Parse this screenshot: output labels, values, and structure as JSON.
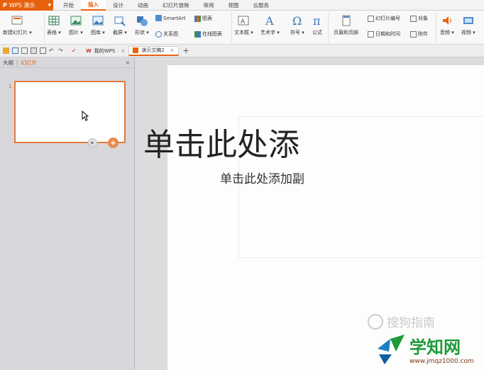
{
  "app": {
    "name": "WPS 演示"
  },
  "menu": {
    "tabs": [
      "开始",
      "插入",
      "设计",
      "动画",
      "幻灯片放映",
      "审阅",
      "视图",
      "云服务"
    ],
    "active_index": 1
  },
  "ribbon": {
    "new_slide": "新建幻灯片",
    "table": "表格",
    "picture": "图片",
    "gallery": "图库",
    "screenshot": "截屏",
    "shape": "形状",
    "smartart": "SmartArt",
    "chart": "图表",
    "relation": "关系图",
    "online_chart": "在线图表",
    "textbox": "文本框",
    "wordart": "艺术字",
    "symbol": "符号",
    "formula": "公式",
    "header_footer": "页眉和页脚",
    "slide_number": "幻灯片编号",
    "object": "对象",
    "date_time": "日期和时间",
    "attachment": "附件",
    "audio": "音频",
    "video": "视频"
  },
  "doc_tabs": [
    {
      "label": "我的WPS"
    },
    {
      "label": "演示文稿2"
    }
  ],
  "left_panel": {
    "outline_label": "大纲",
    "slides_label": "幻灯片",
    "slide_number": "1"
  },
  "slide": {
    "title": "单击此处添",
    "subtitle": "单击此处添加副"
  },
  "watermarks": {
    "sogou": "搜狗指南",
    "site_name": "学知网",
    "site_url": "www.jmqz1000.com"
  },
  "colors": {
    "accent": "#e8620e",
    "thumb_border": "#e07b3b"
  }
}
